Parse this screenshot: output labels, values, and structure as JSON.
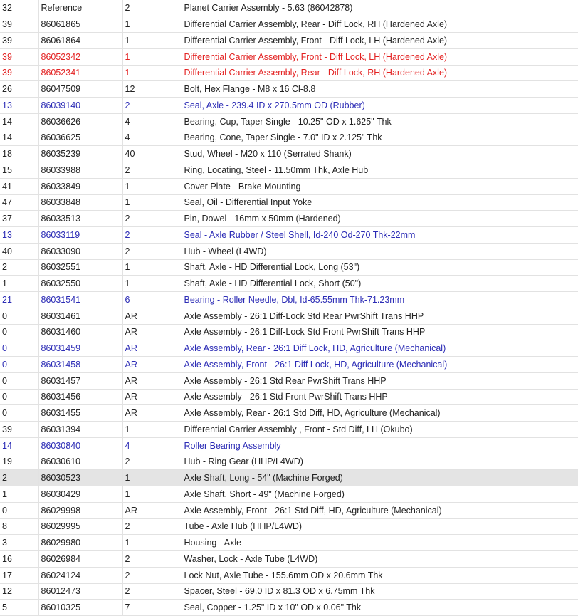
{
  "rows": [
    {
      "ref": "32",
      "part": "Reference",
      "qty": "2",
      "desc": "Planet Carrier Assembly - 5.63 (86042878)",
      "style": "normal"
    },
    {
      "ref": "39",
      "part": "86061865",
      "qty": "1",
      "desc": "Differential Carrier Assembly, Rear - Diff Lock, RH (Hardened Axle)",
      "style": "normal"
    },
    {
      "ref": "39",
      "part": "86061864",
      "qty": "1",
      "desc": "Differential Carrier Assembly, Front - Diff Lock, LH (Hardened Axle)",
      "style": "normal"
    },
    {
      "ref": "39",
      "part": "86052342",
      "qty": "1",
      "desc": "Differential Carrier Assembly, Front - Diff Lock, LH (Hardened Axle)",
      "style": "red"
    },
    {
      "ref": "39",
      "part": "86052341",
      "qty": "1",
      "desc": "Differential Carrier Assembly, Rear - Diff Lock, RH (Hardened Axle)",
      "style": "red"
    },
    {
      "ref": "26",
      "part": "86047509",
      "qty": "12",
      "desc": "Bolt, Hex Flange - M8 x 16 Cl-8.8",
      "style": "normal"
    },
    {
      "ref": "13",
      "part": "86039140",
      "qty": "2",
      "desc": "Seal, Axle - 239.4 ID x 270.5mm OD (Rubber)",
      "style": "blue"
    },
    {
      "ref": "14",
      "part": "86036626",
      "qty": "4",
      "desc": "Bearing, Cup, Taper Single - 10.25\" OD x 1.625\" Thk",
      "style": "normal"
    },
    {
      "ref": "14",
      "part": "86036625",
      "qty": "4",
      "desc": "Bearing, Cone, Taper Single - 7.0\" ID x 2.125\" Thk",
      "style": "normal"
    },
    {
      "ref": "18",
      "part": "86035239",
      "qty": "40",
      "desc": "Stud, Wheel - M20 x 110 (Serrated Shank)",
      "style": "normal"
    },
    {
      "ref": "15",
      "part": "86033988",
      "qty": "2",
      "desc": "Ring, Locating, Steel - 11.50mm Thk, Axle Hub",
      "style": "normal"
    },
    {
      "ref": "41",
      "part": "86033849",
      "qty": "1",
      "desc": "Cover Plate - Brake Mounting",
      "style": "normal"
    },
    {
      "ref": "47",
      "part": "86033848",
      "qty": "1",
      "desc": "Seal, Oil - Differential Input Yoke",
      "style": "normal"
    },
    {
      "ref": "37",
      "part": "86033513",
      "qty": "2",
      "desc": "Pin, Dowel - 16mm x 50mm (Hardened)",
      "style": "normal"
    },
    {
      "ref": "13",
      "part": "86033119",
      "qty": "2",
      "desc": "Seal - Axle Rubber / Steel Shell, Id-240 Od-270 Thk-22mm",
      "style": "blue"
    },
    {
      "ref": "40",
      "part": "86033090",
      "qty": "2",
      "desc": "Hub - Wheel (L4WD)",
      "style": "normal"
    },
    {
      "ref": "2",
      "part": "86032551",
      "qty": "1",
      "desc": "Shaft, Axle - HD Differential Lock, Long (53\")",
      "style": "normal"
    },
    {
      "ref": "1",
      "part": "86032550",
      "qty": "1",
      "desc": "Shaft, Axle - HD Differential Lock, Short (50\")",
      "style": "normal"
    },
    {
      "ref": "21",
      "part": "86031541",
      "qty": "6",
      "desc": "Bearing - Roller Needle, Dbl, Id-65.55mm Thk-71.23mm",
      "style": "blue"
    },
    {
      "ref": "0",
      "part": "86031461",
      "qty": "AR",
      "desc": "Axle Assembly - 26:1 Diff-Lock Std Rear PwrShift Trans HHP",
      "style": "normal"
    },
    {
      "ref": "0",
      "part": "86031460",
      "qty": "AR",
      "desc": "Axle Assembly - 26:1 Diff-Lock Std Front PwrShift Trans HHP",
      "style": "normal"
    },
    {
      "ref": "0",
      "part": "86031459",
      "qty": "AR",
      "desc": "Axle Assembly, Rear - 26:1 Diff Lock, HD, Agriculture (Mechanical)",
      "style": "blue"
    },
    {
      "ref": "0",
      "part": "86031458",
      "qty": "AR",
      "desc": "Axle Assembly, Front - 26:1 Diff Lock, HD, Agriculture (Mechanical)",
      "style": "blue"
    },
    {
      "ref": "0",
      "part": "86031457",
      "qty": "AR",
      "desc": "Axle Assembly - 26:1 Std Rear PwrShift Trans HHP",
      "style": "normal"
    },
    {
      "ref": "0",
      "part": "86031456",
      "qty": "AR",
      "desc": "Axle Assembly - 26:1 Std Front PwrShift Trans HHP",
      "style": "normal"
    },
    {
      "ref": "0",
      "part": "86031455",
      "qty": "AR",
      "desc": "Axle Assembly, Rear - 26:1 Std Diff, HD, Agriculture (Mechanical)",
      "style": "normal"
    },
    {
      "ref": "39",
      "part": "86031394",
      "qty": "1",
      "desc": "Differential Carrier Assembly , Front - Std Diff, LH (Okubo)",
      "style": "normal"
    },
    {
      "ref": "14",
      "part": "86030840",
      "qty": "4",
      "desc": "Roller Bearing Assembly",
      "style": "blue"
    },
    {
      "ref": "19",
      "part": "86030610",
      "qty": "2",
      "desc": "Hub - Ring Gear (HHP/L4WD)",
      "style": "normal"
    },
    {
      "ref": "2",
      "part": "86030523",
      "qty": "1",
      "desc": "Axle Shaft, Long - 54\" (Machine Forged)",
      "style": "hl"
    },
    {
      "ref": "1",
      "part": "86030429",
      "qty": "1",
      "desc": "Axle Shaft, Short - 49\" (Machine Forged)",
      "style": "normal"
    },
    {
      "ref": "0",
      "part": "86029998",
      "qty": "AR",
      "desc": "Axle Assembly, Front - 26:1 Std Diff, HD, Agriculture (Mechanical)",
      "style": "normal"
    },
    {
      "ref": "8",
      "part": "86029995",
      "qty": "2",
      "desc": "Tube - Axle Hub (HHP/L4WD)",
      "style": "normal"
    },
    {
      "ref": "3",
      "part": "86029980",
      "qty": "1",
      "desc": "Housing - Axle",
      "style": "normal"
    },
    {
      "ref": "16",
      "part": "86026984",
      "qty": "2",
      "desc": "Washer, Lock - Axle Tube (L4WD)",
      "style": "normal"
    },
    {
      "ref": "17",
      "part": "86024124",
      "qty": "2",
      "desc": "Lock Nut, Axle Tube - 155.6mm OD x 20.6mm Thk",
      "style": "normal"
    },
    {
      "ref": "12",
      "part": "86012473",
      "qty": "2",
      "desc": "Spacer, Steel - 69.0 ID x 81.3 OD x 6.75mm Thk",
      "style": "normal"
    },
    {
      "ref": "5",
      "part": "86010325",
      "qty": "7",
      "desc": "Seal, Copper - 1.25\" ID x 10\" OD x 0.06\" Thk",
      "style": "normal"
    }
  ]
}
